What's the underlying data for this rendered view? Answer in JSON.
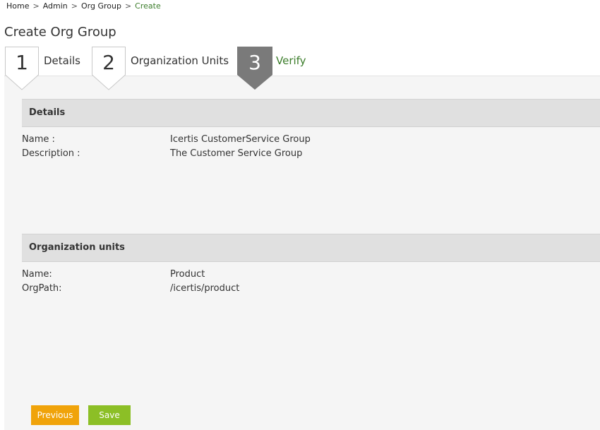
{
  "breadcrumb": {
    "items": [
      "Home",
      "Admin",
      "Org Group"
    ],
    "current": "Create",
    "separator": ">"
  },
  "page": {
    "title": "Create Org Group"
  },
  "wizard": {
    "steps": [
      {
        "number": "1",
        "label": "Details",
        "state": "default"
      },
      {
        "number": "2",
        "label": "Organization Units",
        "state": "default"
      },
      {
        "number": "3",
        "label": "Verify",
        "state": "active"
      }
    ]
  },
  "details": {
    "header": "Details",
    "fields": [
      {
        "label": "Name :",
        "value": "Icertis CustomerService Group"
      },
      {
        "label": "Description :",
        "value": "The Customer Service Group"
      }
    ]
  },
  "org_units": {
    "header": "Organization units",
    "fields": [
      {
        "label": "Name:",
        "value": "Product"
      },
      {
        "label": "OrgPath:",
        "value": "/icertis/product"
      }
    ]
  },
  "buttons": {
    "previous": "Previous",
    "save": "Save"
  },
  "colors": {
    "accent_green": "#3c7d2b",
    "active_step": "#7a7a7a",
    "previous_button": "#f0a30a",
    "save_button": "#8cbf26"
  }
}
